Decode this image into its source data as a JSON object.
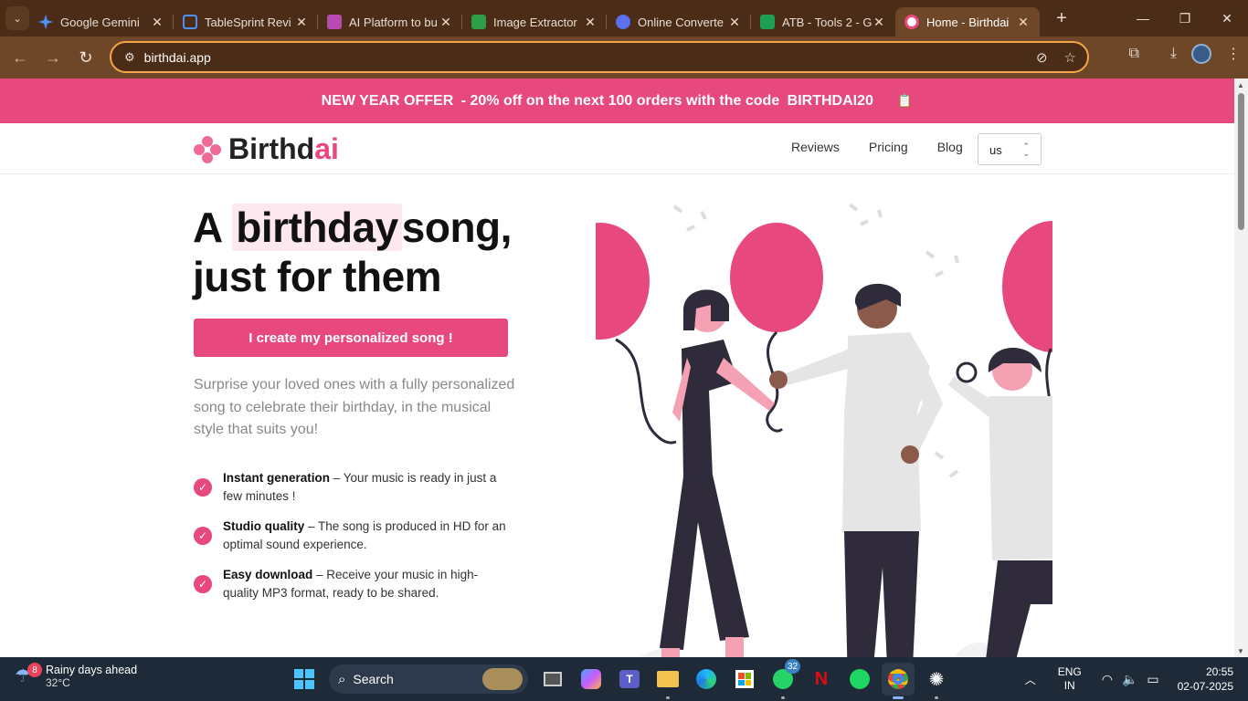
{
  "browser": {
    "tabs": [
      {
        "title": "Google Gemini",
        "favicon_color": "#4f8df5"
      },
      {
        "title": "TableSprint Revi",
        "favicon_color": "#2f6fd6"
      },
      {
        "title": "AI Platform to bu",
        "favicon_color": "#b74ab0"
      },
      {
        "title": "Image Extractor",
        "favicon_color": "#2e9e48"
      },
      {
        "title": "Online Converte",
        "favicon_color": "#5b6ff0"
      },
      {
        "title": "ATB - Tools 2 - G",
        "favicon_color": "#1e9d55"
      },
      {
        "title": "Home - Birthdai",
        "favicon_color": "#e7487e"
      }
    ],
    "url": "birthdai.app"
  },
  "page": {
    "promo": {
      "prefix": "NEW YEAR OFFER",
      "middle": " - 20% off on the next 100 orders with the code ",
      "code": "BIRTHDAI20"
    },
    "logo": {
      "part1": "Birthd",
      "part2": "ai"
    },
    "nav": [
      "Reviews",
      "Pricing",
      "Blog"
    ],
    "language_select": "us",
    "hero": {
      "title_a": "A",
      "title_highlight": "birthday",
      "title_rest": "song,",
      "title_line2": "just for them",
      "cta": "I create my personalized song !",
      "subtitle": "Surprise your loved ones with a fully personalized song to celebrate their birthday, in the musical style that suits you!"
    },
    "features": [
      {
        "title": "Instant generation",
        "text": " – Your music is ready in just a few minutes !"
      },
      {
        "title": "Studio quality",
        "text": " – The song is produced in HD for an optimal sound experience."
      },
      {
        "title": "Easy download",
        "text": " – Receive your music in high-quality MP3 format, ready to be shared."
      }
    ],
    "accent_color": "#e7487e"
  },
  "taskbar": {
    "weather": {
      "line1": "Rainy days ahead",
      "line2": "32°C",
      "badge": "8"
    },
    "search_label": "Search",
    "whatsapp_badge": "32",
    "lang": {
      "line1": "ENG",
      "line2": "IN"
    },
    "time": "20:55",
    "date": "02-07-2025"
  }
}
